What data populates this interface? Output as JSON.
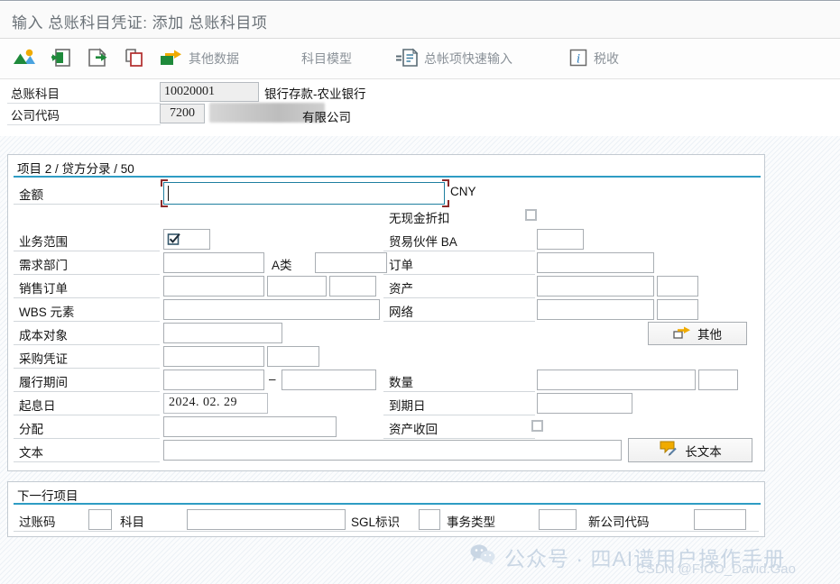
{
  "window": {
    "title": "输入 总账科目凭证: 添加 总账科目项"
  },
  "toolbar": {
    "items": [
      {
        "name": "picture-icon",
        "label": ""
      },
      {
        "name": "previous-item-icon",
        "label": ""
      },
      {
        "name": "next-item-icon",
        "label": ""
      },
      {
        "name": "copy-icon",
        "label": ""
      },
      {
        "name": "more-data-icon",
        "label": "其他数据"
      },
      {
        "name": "account-model",
        "label": "科目模型"
      },
      {
        "name": "fast-entry-icon",
        "label": "总帐项快速输入"
      },
      {
        "name": "tax-info-icon",
        "label": "税收"
      }
    ]
  },
  "header": {
    "gl_account_label": "总账科目",
    "gl_account_value": "10020001",
    "gl_account_desc": "银行存款-农业银行",
    "company_code_label": "公司代码",
    "company_code_value": "7200",
    "company_name_suffix": "有限公司"
  },
  "item_panel": {
    "title": "项目 2 / 贷方分录 / 50",
    "left_fields": [
      {
        "label": "金额",
        "value": ""
      },
      {
        "label": "业务范围",
        "value": ""
      },
      {
        "label": "需求部门",
        "value": ""
      },
      {
        "label": "销售订单",
        "value": ""
      },
      {
        "label": "WBS 元素",
        "value": ""
      },
      {
        "label": "成本对象",
        "value": ""
      },
      {
        "label": "采购凭证",
        "value": ""
      },
      {
        "label": "履行期间",
        "value": ""
      },
      {
        "label": "起息日",
        "value": "2024. 02. 29"
      },
      {
        "label": "分配",
        "value": ""
      },
      {
        "label": "文本",
        "value": ""
      }
    ],
    "right_fields": [
      {
        "label": "无现金折扣",
        "value": ""
      },
      {
        "label": "贸易伙伴 BA",
        "value": ""
      },
      {
        "label": "订单",
        "value": ""
      },
      {
        "label": "资产",
        "value": ""
      },
      {
        "label": "网络",
        "value": ""
      },
      {
        "label": "数量",
        "value": ""
      },
      {
        "label": "到期日",
        "value": ""
      },
      {
        "label": "资产收回",
        "value": ""
      }
    ],
    "sub_labels": {
      "a_class": "A类",
      "period_dash": "–"
    },
    "currency": "CNY",
    "more_button": "其他",
    "long_text_button": "长文本"
  },
  "next_line_panel": {
    "title": "下一行项目",
    "fields": [
      {
        "label": "过账码",
        "value": ""
      },
      {
        "label": "科目",
        "value": ""
      },
      {
        "label": "SGL标识",
        "value": ""
      },
      {
        "label": "事务类型",
        "value": ""
      },
      {
        "label": "新公司代码",
        "value": ""
      }
    ]
  },
  "watermark": {
    "wechat": "公众号 · 四AI谱用户操作手册",
    "csdn": "CSDN @FICO_David.Gao"
  },
  "colors": {
    "accent": "#2e9cc4",
    "title_text": "#6b7278",
    "focus_border": "#1f7fa0",
    "focus_corner": "#8c2b2b",
    "icon_green": "#1f8a3b",
    "icon_orange": "#f0ab00",
    "icon_blue": "#4aa3df",
    "icon_red": "#b02a2a",
    "watermark": "#c9d6e4"
  }
}
